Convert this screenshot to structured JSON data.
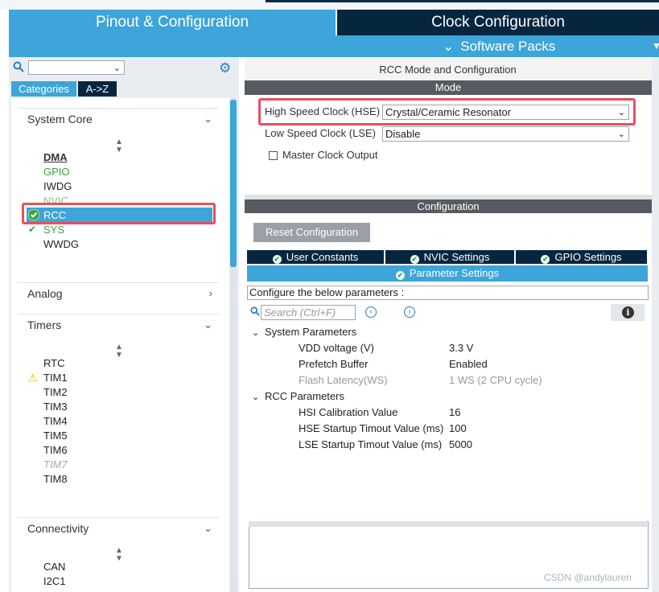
{
  "tabs": {
    "pinout": "Pinout & Configuration",
    "clock": "Clock Configuration",
    "software_packs": "Software Packs"
  },
  "left": {
    "category_tabs": [
      "Categories",
      "A->Z"
    ],
    "sections": {
      "system_core": "System Core",
      "analog": "Analog",
      "timers": "Timers",
      "connectivity": "Connectivity"
    },
    "system_core_items": [
      "DMA",
      "GPIO",
      "IWDG",
      "NVIC",
      "RCC",
      "SYS",
      "WWDG"
    ],
    "timers_items": [
      "RTC",
      "TIM1",
      "TIM2",
      "TIM3",
      "TIM4",
      "TIM5",
      "TIM6",
      "TIM7",
      "TIM8"
    ],
    "connectivity_items": [
      "CAN",
      "I2C1"
    ]
  },
  "right": {
    "title": "RCC Mode and Configuration",
    "mode_header": "Mode",
    "hse_label": "High Speed Clock (HSE)",
    "hse_value": "Crystal/Ceramic Resonator",
    "lse_label": "Low Speed Clock (LSE)",
    "lse_value": "Disable",
    "mco_label": "Master Clock Output",
    "config_header": "Configuration",
    "reset_button": "Reset Configuration",
    "config_tabs": [
      "User Constants",
      "NVIC Settings",
      "GPIO Settings"
    ],
    "param_tab": "Parameter Settings",
    "configure_label": "Configure the below parameters :",
    "search_placeholder": "Search (Ctrl+F)",
    "groups": {
      "system": "System Parameters",
      "rcc": "RCC Parameters"
    },
    "system_params": [
      {
        "name": "VDD voltage (V)",
        "value": "3.3 V"
      },
      {
        "name": "Prefetch Buffer",
        "value": "Enabled"
      },
      {
        "name": "Flash Latency(WS)",
        "value": "1 WS (2 CPU cycle)"
      }
    ],
    "rcc_params": [
      {
        "name": "HSI Calibration Value",
        "value": "16"
      },
      {
        "name": "HSE Startup Timout Value (ms)",
        "value": "100"
      },
      {
        "name": "LSE Startup Timout Value (ms)",
        "value": "5000"
      }
    ]
  },
  "watermark": "CSDN @andylauren",
  "colors": {
    "accent": "#3da5d9",
    "dark_navy": "#06263f",
    "highlight_red": "#e8505b",
    "ok_green": "#3aa53a"
  }
}
